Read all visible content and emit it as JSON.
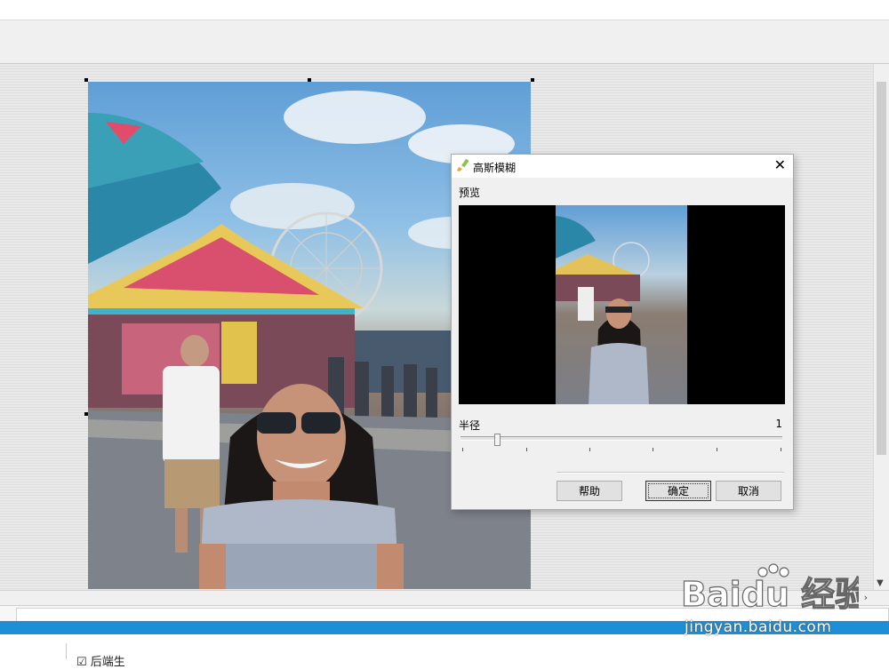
{
  "dialog": {
    "title": "高斯模糊",
    "preview_label": "预览",
    "radius_label": "半径",
    "radius_value": "1",
    "slider_value": 1,
    "buttons": {
      "help": "帮助",
      "ok": "确定",
      "cancel": "取消"
    }
  },
  "bottom": {
    "checkbox_label": "☑ 后端生"
  },
  "watermark": {
    "brand": "Baidu 经验",
    "url": "jingyan.baidu.com"
  },
  "icons": {
    "dialog_icon": "brush-icon",
    "close": "close-icon",
    "scroll_down": "chevron-down-icon",
    "scroll_right": "chevron-right-icon"
  },
  "colors": {
    "status_bar": "#1e8fd6",
    "dialog_bg": "#f0f0f0"
  }
}
